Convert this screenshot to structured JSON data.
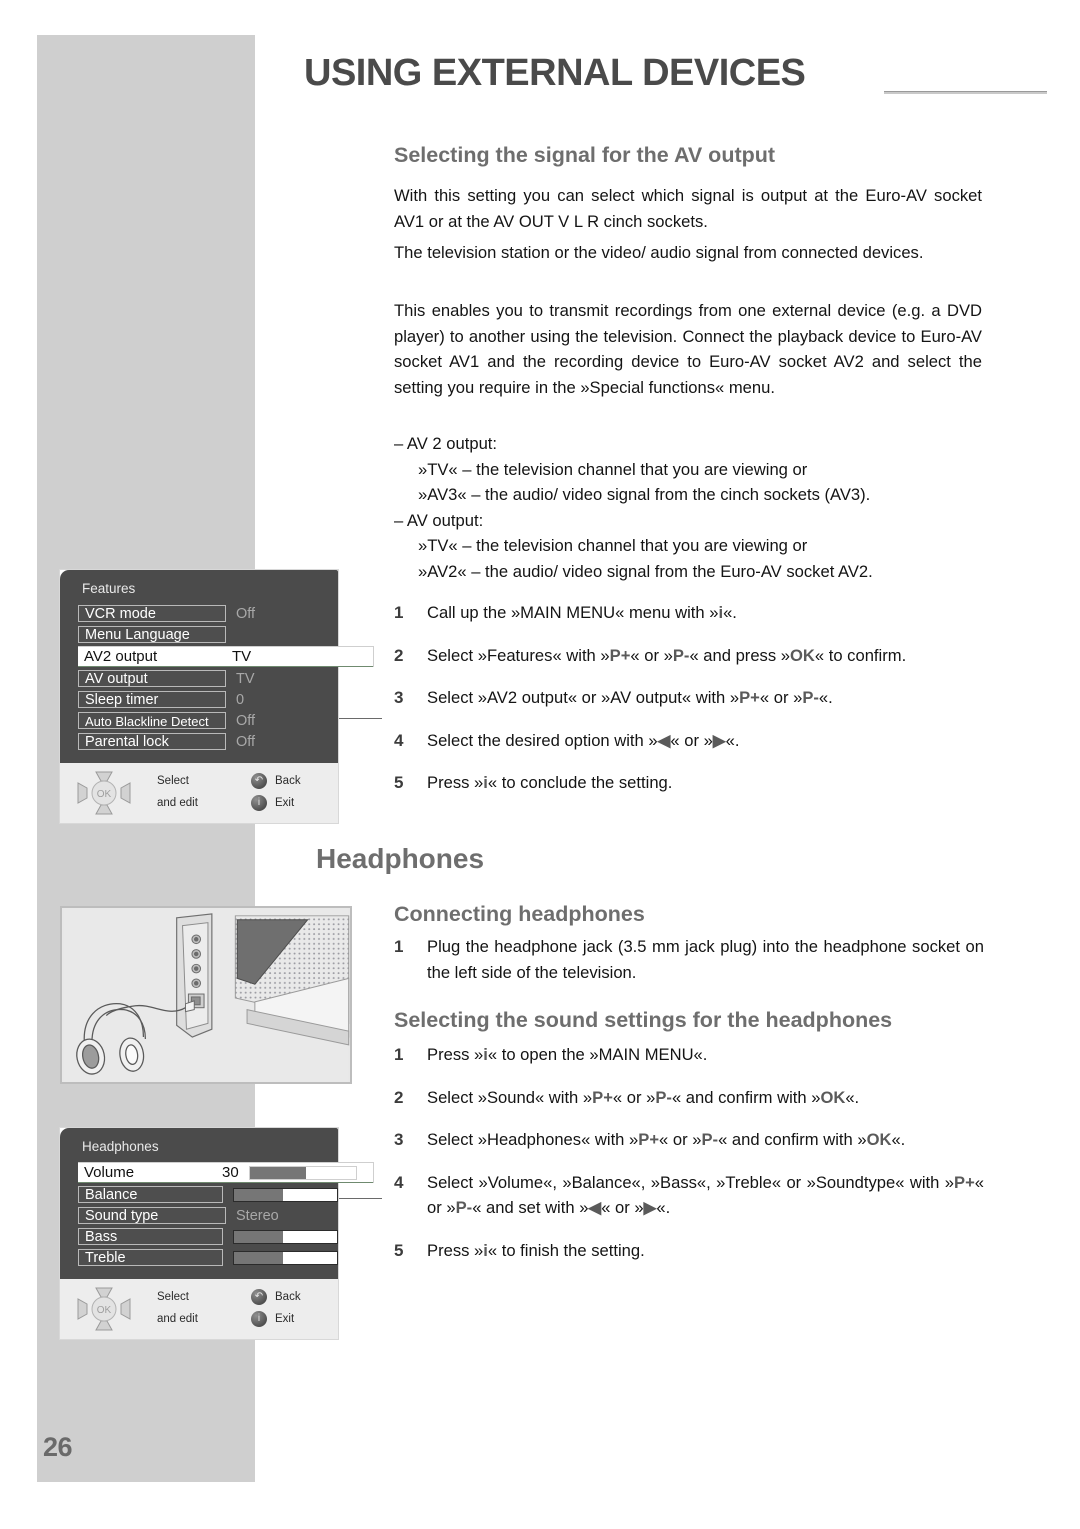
{
  "page": {
    "number": "26",
    "title": "USING EXTERNAL DEVICES"
  },
  "sections": {
    "av_output": {
      "heading": "Selecting the signal for the AV output",
      "paragraphs": [
        "With this setting you can select which signal is output at the Euro-AV socket AV1 or at the AV OUT V L R cinch sockets.",
        "The television station or the video/ audio signal from connected devices.",
        "This enables you to transmit recordings from one external device (e.g. a DVD player) to another using the television. Connect the playback device to Euro-AV socket AV1 and the recording device to Euro-AV socket AV2 and select the setting you require in the »Special functions« menu."
      ],
      "bullets": [
        "– AV 2 output:",
        "»TV« – the television channel that you are viewing or",
        "»AV3« – the audio/ video signal from the cinch sockets (AV3).",
        "– AV output:",
        "»TV« – the television channel that you are viewing or",
        "»AV2« – the audio/ video signal from the Euro-AV socket AV2."
      ],
      "steps": [
        {
          "num": "1",
          "text": "Call up the »MAIN MENU« menu with »i«."
        },
        {
          "num": "2",
          "text": "Select »Features« with »P+« or »P-« and press »OK« to confirm."
        },
        {
          "num": "3",
          "text": "Select »AV2 output« or »AV output« with »P+« or »P-«."
        },
        {
          "num": "4",
          "text": "Select the desired option with »◀« or »▶«."
        },
        {
          "num": "5",
          "text": "Press »i« to conclude the setting."
        }
      ]
    },
    "headphones": {
      "heading": "Headphones",
      "connecting": {
        "heading": "Connecting headphones",
        "steps": [
          {
            "num": "1",
            "text": "Plug the headphone jack (3.5 mm jack plug) into the headphone socket on the left side of the television."
          }
        ]
      },
      "sound_settings": {
        "heading": "Selecting the sound settings for the headphones",
        "steps": [
          {
            "num": "1",
            "text": "Press »i« to open the »MAIN MENU«."
          },
          {
            "num": "2",
            "text": "Select »Sound« with »P+« or »P-« and confirm with »OK«."
          },
          {
            "num": "3",
            "text": "Select »Headphones« with »P+« or »P-« and confirm with »OK«."
          },
          {
            "num": "4",
            "text": "Select »Volume«, »Balance«, »Bass«, »Treble« or »Soundtype« with »P+« or »P-« and set with »◀« or »▶«."
          },
          {
            "num": "5",
            "text": "Press »i« to finish the setting."
          }
        ]
      }
    }
  },
  "osd_features": {
    "title": "Features",
    "rows": [
      {
        "label": "VCR mode",
        "value": "Off",
        "selected": false,
        "type": "value"
      },
      {
        "label": "Menu Language",
        "value": "",
        "selected": false,
        "type": "value"
      },
      {
        "label": "AV2 output",
        "value": "TV",
        "selected": true,
        "type": "value"
      },
      {
        "label": "AV output",
        "value": "TV",
        "selected": false,
        "type": "value"
      },
      {
        "label": "Sleep timer",
        "value": "0",
        "selected": false,
        "type": "value"
      },
      {
        "label": "Auto Blackline Detect",
        "value": "Off",
        "selected": false,
        "type": "value"
      },
      {
        "label": "Parental lock",
        "value": "Off",
        "selected": false,
        "type": "value"
      }
    ],
    "footer": {
      "ok_label": "OK",
      "select_label": "Select",
      "edit_label": "and edit",
      "back_label": "Back",
      "exit_label": "Exit",
      "back_icon": "back-arrow-icon",
      "exit_icon": "info-icon"
    }
  },
  "osd_headphones": {
    "title": "Headphones",
    "rows": [
      {
        "label": "Volume",
        "value": "30",
        "selected": true,
        "type": "slider",
        "fill": 53
      },
      {
        "label": "Balance",
        "value": "",
        "selected": false,
        "type": "slider",
        "fill": 48
      },
      {
        "label": "Sound type",
        "value": "Stereo",
        "selected": false,
        "type": "value"
      },
      {
        "label": "Bass",
        "value": "",
        "selected": false,
        "type": "slider",
        "fill": 48
      },
      {
        "label": "Treble",
        "value": "",
        "selected": false,
        "type": "slider",
        "fill": 48
      }
    ],
    "footer": {
      "ok_label": "OK",
      "select_label": "Select",
      "edit_label": "and edit",
      "back_label": "Back",
      "exit_label": "Exit",
      "back_icon": "back-arrow-icon",
      "exit_icon": "info-icon"
    }
  },
  "illustration": {
    "name": "headphones-connected-to-tv-illustration",
    "alt": "Headphones plugged into the socket panel on the left side of the television"
  },
  "colors": {
    "band_gray": "#cfcfcf",
    "heading_gray": "#6e6e6e",
    "title_gray": "#4a4a4a",
    "osd_bg": "#4b4b4b",
    "osd_foot": "#ededed",
    "keyword_gray": "#5a5a5a"
  }
}
